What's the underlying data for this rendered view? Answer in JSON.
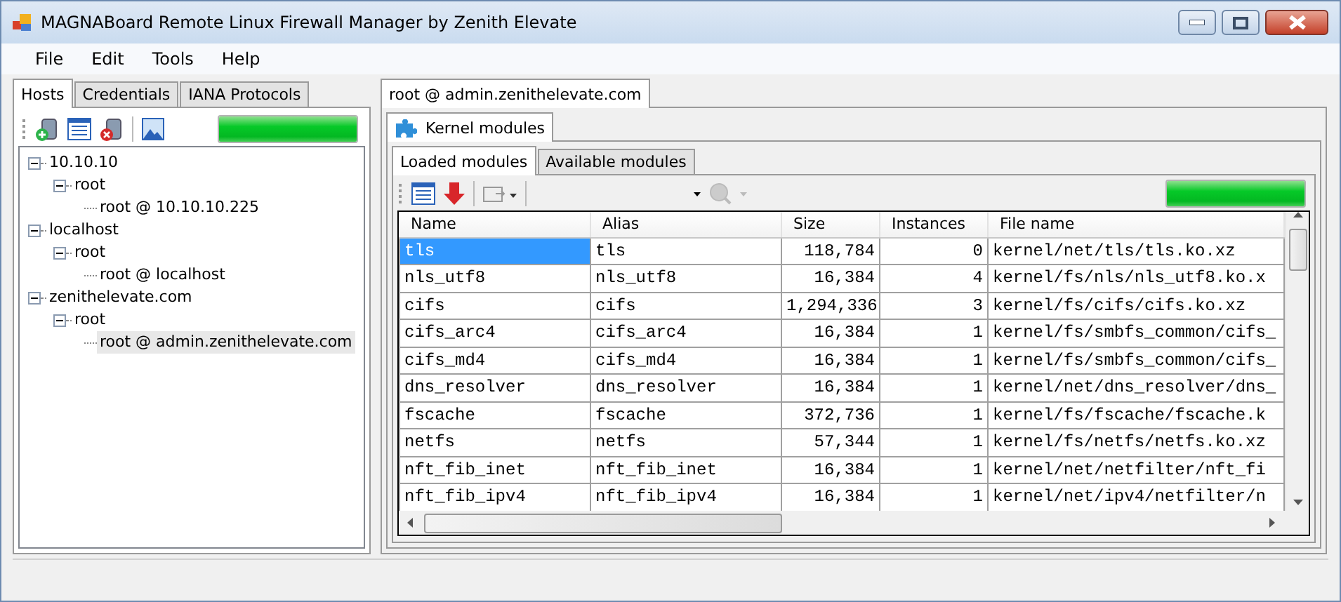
{
  "window": {
    "title": "MAGNABoard Remote Linux Firewall Manager by Zenith Elevate"
  },
  "menu": [
    "File",
    "Edit",
    "Tools",
    "Help"
  ],
  "left_panel": {
    "tabs": [
      {
        "label": "Hosts",
        "selected": true
      },
      {
        "label": "Credentials",
        "selected": false
      },
      {
        "label": "IANA Protocols",
        "selected": false
      }
    ],
    "progress": {
      "level": 1
    },
    "tree": [
      {
        "label": "10.10.10",
        "expanded": true,
        "selected": false,
        "children": [
          {
            "label": "root",
            "expanded": true,
            "selected": false,
            "children": [
              {
                "label": "root @ 10.10.10.225",
                "selected": false
              }
            ]
          }
        ]
      },
      {
        "label": "localhost",
        "expanded": true,
        "selected": false,
        "children": [
          {
            "label": "root",
            "expanded": true,
            "selected": false,
            "children": [
              {
                "label": "root @ localhost",
                "selected": false
              }
            ]
          }
        ]
      },
      {
        "label": "zenithelevate.com",
        "expanded": true,
        "selected": false,
        "children": [
          {
            "label": "root",
            "expanded": true,
            "selected": false,
            "children": [
              {
                "label": "root @ admin.zenithelevate.com",
                "selected": true
              }
            ]
          }
        ]
      }
    ]
  },
  "right_panel": {
    "tabs": [
      {
        "label": "root @ admin.zenithelevate.com",
        "selected": true
      }
    ],
    "module_tabs": [
      {
        "label": "Kernel modules",
        "selected": true
      }
    ],
    "sub_tabs": [
      {
        "label": "Loaded modules",
        "selected": true
      },
      {
        "label": "Available modules",
        "selected": false
      }
    ],
    "progress": {
      "level": 1
    },
    "table": {
      "columns": [
        "Name",
        "Alias",
        "Size",
        "Instances",
        "File name"
      ],
      "rows": [
        {
          "cells": [
            "tls",
            "tls",
            "118,784",
            "0",
            "kernel/net/tls/tls.ko.xz"
          ],
          "selected": true
        },
        {
          "cells": [
            "nls_utf8",
            "nls_utf8",
            "16,384",
            "4",
            "kernel/fs/nls/nls_utf8.ko.x"
          ],
          "selected": false
        },
        {
          "cells": [
            "cifs",
            "cifs",
            "1,294,336",
            "3",
            "kernel/fs/cifs/cifs.ko.xz"
          ],
          "selected": false
        },
        {
          "cells": [
            "cifs_arc4",
            "cifs_arc4",
            "16,384",
            "1",
            "kernel/fs/smbfs_common/cifs_"
          ],
          "selected": false
        },
        {
          "cells": [
            "cifs_md4",
            "cifs_md4",
            "16,384",
            "1",
            "kernel/fs/smbfs_common/cifs_"
          ],
          "selected": false
        },
        {
          "cells": [
            "dns_resolver",
            "dns_resolver",
            "16,384",
            "1",
            "kernel/net/dns_resolver/dns_"
          ],
          "selected": false
        },
        {
          "cells": [
            "fscache",
            "fscache",
            "372,736",
            "1",
            "kernel/fs/fscache/fscache.k"
          ],
          "selected": false
        },
        {
          "cells": [
            "netfs",
            "netfs",
            "57,344",
            "1",
            "kernel/fs/netfs/netfs.ko.xz"
          ],
          "selected": false
        },
        {
          "cells": [
            "nft_fib_inet",
            "nft_fib_inet",
            "16,384",
            "1",
            "kernel/net/netfilter/nft_fi"
          ],
          "selected": false
        },
        {
          "cells": [
            "nft_fib_ipv4",
            "nft_fib_ipv4",
            "16,384",
            "1",
            "kernel/net/ipv4/netfilter/n"
          ],
          "selected": false
        }
      ]
    }
  }
}
